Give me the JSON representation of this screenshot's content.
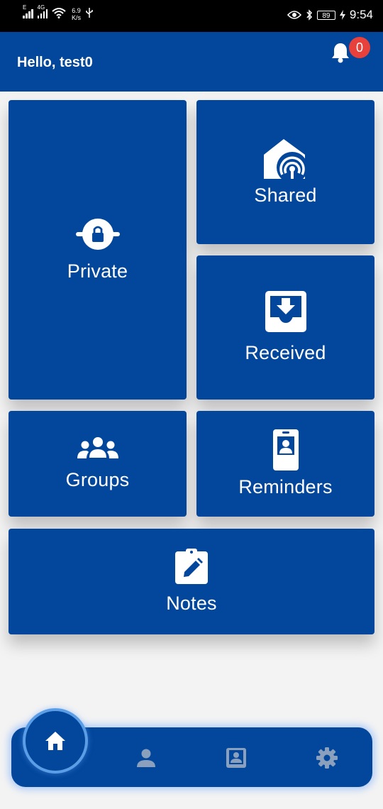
{
  "status_bar": {
    "signal_1_label": "E",
    "signal_2_label": "4G",
    "net_speed_value": "6.9",
    "net_speed_unit": "K/s",
    "battery": "89",
    "time": "9:54"
  },
  "header": {
    "greeting": "Hello, test0",
    "notification_count": "0"
  },
  "tiles": {
    "private": "Private",
    "shared": "Shared",
    "received": "Received",
    "groups": "Groups",
    "reminders": "Reminders",
    "notes": "Notes"
  },
  "colors": {
    "primary": "#02479b",
    "badge": "#e8403a",
    "nav_inactive": "#8aa0bc",
    "home_ring": "#5b9ee6"
  },
  "bottom_nav": {
    "items": [
      "home-icon",
      "person-icon",
      "contact-card-icon",
      "gear-icon"
    ],
    "active": "home-icon"
  }
}
